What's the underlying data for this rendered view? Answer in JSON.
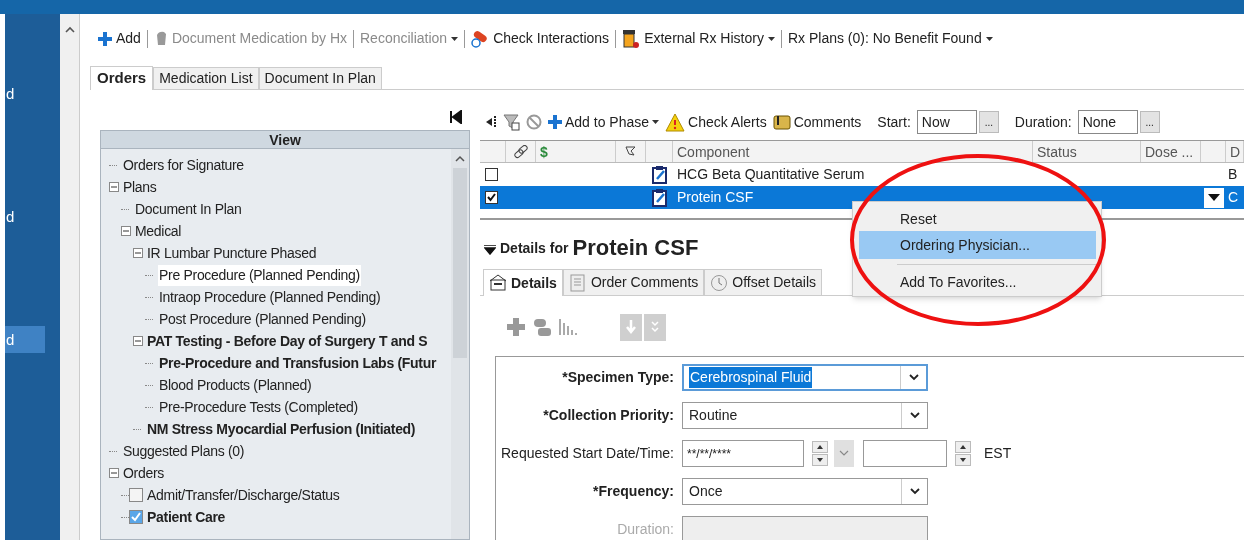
{
  "sidebar": {
    "items": [
      {
        "label": "d",
        "selected": false
      },
      {
        "label": "d",
        "selected": false
      },
      {
        "label": "d",
        "selected": true
      }
    ]
  },
  "toolbar": [
    {
      "kind": "add",
      "label": "Add",
      "disabled": false,
      "dropdown": false
    },
    {
      "kind": "document",
      "label": "Document Medication by Hx",
      "disabled": true,
      "dropdown": false
    },
    {
      "kind": "plain",
      "label": "Reconciliation",
      "disabled": true,
      "dropdown": true
    },
    {
      "kind": "interactions",
      "label": "Check Interactions",
      "disabled": false,
      "dropdown": false
    },
    {
      "kind": "bottle",
      "label": "External Rx History",
      "disabled": false,
      "dropdown": true
    },
    {
      "kind": "plain",
      "label": "Rx Plans (0): No Benefit Found",
      "disabled": false,
      "dropdown": true
    }
  ],
  "tabs": [
    {
      "label": "Orders",
      "selected": true
    },
    {
      "label": "Medication List",
      "selected": false
    },
    {
      "label": "Document In Plan",
      "selected": false
    }
  ],
  "view_panel": {
    "title": "View",
    "tree": [
      {
        "kind": "leaf",
        "label": "Orders for Signature",
        "bold": false,
        "selected": false
      },
      {
        "kind": "group",
        "label": "Plans",
        "bold": false,
        "selected": false,
        "expanded": true,
        "children": [
          {
            "kind": "leaf",
            "label": "Document In Plan",
            "bold": false,
            "selected": false
          },
          {
            "kind": "group",
            "label": "Medical",
            "bold": false,
            "selected": false,
            "expanded": true,
            "children": [
              {
                "kind": "group",
                "label": "IR Lumbar Puncture Phased",
                "bold": false,
                "selected": false,
                "expanded": true,
                "children": [
                  {
                    "kind": "leaf",
                    "label": "Pre Procedure (Planned Pending)",
                    "bold": false,
                    "selected": true
                  },
                  {
                    "kind": "leaf",
                    "label": "Intraop Procedure (Planned Pending)",
                    "bold": false,
                    "selected": false
                  },
                  {
                    "kind": "leaf",
                    "label": "Post Procedure (Planned Pending)",
                    "bold": false,
                    "selected": false
                  }
                ]
              },
              {
                "kind": "group",
                "label": "PAT Testing - Before Day of Surgery T and S",
                "bold": true,
                "selected": false,
                "expanded": true,
                "children": [
                  {
                    "kind": "leaf",
                    "label": "Pre-Procedure and Transfusion Labs (Futur",
                    "bold": true,
                    "selected": false
                  },
                  {
                    "kind": "leaf",
                    "label": "Blood Products (Planned)",
                    "bold": false,
                    "selected": false
                  },
                  {
                    "kind": "leaf",
                    "label": "Pre-Procedure Tests (Completed)",
                    "bold": false,
                    "selected": false
                  }
                ]
              },
              {
                "kind": "leaf",
                "label": "NM Stress Myocardial Perfusion (Initiated)",
                "bold": true,
                "selected": false
              }
            ]
          }
        ]
      },
      {
        "kind": "leaf",
        "label": "Suggested Plans (0)",
        "bold": false,
        "selected": false
      },
      {
        "kind": "group",
        "label": "Orders",
        "bold": false,
        "selected": false,
        "expanded": true,
        "children": [
          {
            "kind": "checkbox",
            "label": "Admit/Transfer/Discharge/Status",
            "bold": false,
            "selected": false,
            "checked": false
          },
          {
            "kind": "checkbox",
            "label": "Patient Care",
            "bold": true,
            "selected": false,
            "checked": true
          }
        ]
      }
    ]
  },
  "order_toolbar": {
    "items": [
      {
        "kind": "add",
        "label": "Add to Phase",
        "dropdown": true
      },
      {
        "kind": "alert",
        "label": "Check Alerts",
        "dropdown": false
      },
      {
        "kind": "comment",
        "label": "Comments",
        "dropdown": false
      }
    ],
    "start": {
      "label": "Start:",
      "value": "Now",
      "button": "..."
    },
    "duration": {
      "label": "Duration:",
      "value": "None",
      "button": "..."
    }
  },
  "grid": {
    "columns": [
      {
        "kind": "checkbox"
      },
      {
        "kind": "link-icon"
      },
      {
        "kind": "text",
        "label": "$"
      },
      {
        "kind": "flag-icon"
      },
      {
        "kind": "blank"
      },
      {
        "kind": "text",
        "label": "Component"
      },
      {
        "kind": "text",
        "label": "Status"
      },
      {
        "kind": "text",
        "label": "Dose ..."
      },
      {
        "kind": "blank"
      },
      {
        "kind": "text",
        "label": "D"
      }
    ],
    "rows": [
      {
        "checked": false,
        "selected": false,
        "component": "HCG Beta Quantitative Serum",
        "column_10": "B"
      },
      {
        "checked": true,
        "selected": true,
        "component": "Protein CSF",
        "column_10": "C"
      }
    ]
  },
  "context_menu": {
    "items": [
      {
        "label": "Reset",
        "selected": false,
        "separator_before": false
      },
      {
        "label": "Ordering Physician...",
        "selected": true,
        "separator_before": false
      },
      {
        "label": "Add To Favorites...",
        "selected": false,
        "separator_before": true
      }
    ]
  },
  "details": {
    "title_prefix": "Details for",
    "title": "Protein CSF",
    "tabs": [
      {
        "kind": "details",
        "label": "Details",
        "selected": true
      },
      {
        "kind": "comments",
        "label": "Order Comments",
        "selected": false
      },
      {
        "kind": "offset",
        "label": "Offset Details",
        "selected": false
      }
    ],
    "fields": [
      {
        "kind": "dropdown",
        "label": "*Specimen Type:",
        "required": true,
        "value": "Cerebrospinal Fluid",
        "focused": true
      },
      {
        "kind": "dropdown",
        "label": "*Collection Priority:",
        "required": true,
        "value": "Routine",
        "focused": false
      },
      {
        "kind": "datetime",
        "label": "Requested Start Date/Time:",
        "required": false,
        "value": "**/**/****",
        "timezone": "EST"
      },
      {
        "kind": "dropdown",
        "label": "*Frequency:",
        "required": true,
        "value": "Once",
        "focused": false
      },
      {
        "kind": "text",
        "label": "Duration:",
        "required": false,
        "disabled": true
      }
    ]
  },
  "annotation": {
    "kind": "ellipse",
    "color": "#ee1111"
  }
}
